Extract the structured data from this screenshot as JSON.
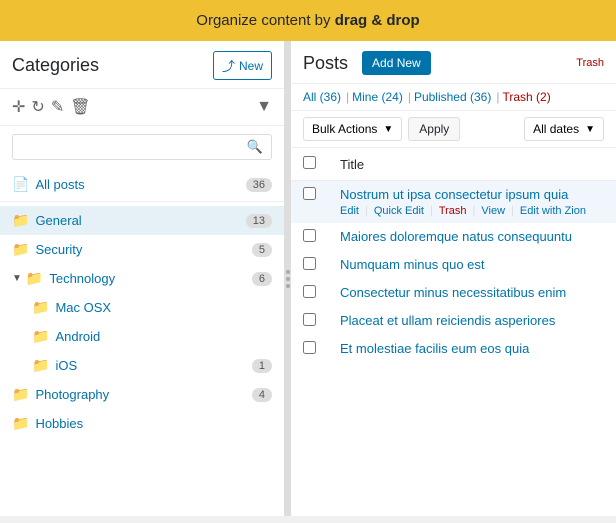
{
  "banner": {
    "text_prefix": "Organize content by ",
    "text_bold": "drag & drop"
  },
  "sidebar": {
    "title": "Categories",
    "new_button": "New",
    "search_placeholder": "",
    "all_posts": {
      "label": "All posts",
      "count": "36"
    },
    "categories": [
      {
        "id": "general",
        "label": "General",
        "count": "13",
        "indent": 0,
        "active": true
      },
      {
        "id": "security",
        "label": "Security",
        "count": "5",
        "indent": 0
      },
      {
        "id": "technology",
        "label": "Technology",
        "count": "6",
        "indent": 0,
        "expanded": true
      },
      {
        "id": "mac-osx",
        "label": "Mac OSX",
        "count": "",
        "indent": 1
      },
      {
        "id": "android",
        "label": "Android",
        "count": "",
        "indent": 1
      },
      {
        "id": "ios",
        "label": "iOS",
        "count": "1",
        "indent": 1
      },
      {
        "id": "photography",
        "label": "Photography",
        "count": "4",
        "indent": 0
      },
      {
        "id": "hobbies",
        "label": "Hobbies",
        "count": "",
        "indent": 0
      }
    ]
  },
  "posts_panel": {
    "title": "Posts",
    "add_new_label": "Add New",
    "filter_links": [
      {
        "id": "all",
        "label": "All",
        "count": "36",
        "active": true
      },
      {
        "id": "mine",
        "label": "Mine",
        "count": "24"
      },
      {
        "id": "published",
        "label": "Published",
        "count": "36"
      },
      {
        "id": "trash",
        "label": "Trash",
        "count": "2",
        "is_trash": true
      }
    ],
    "bulk_actions_label": "Bulk Actions",
    "apply_label": "Apply",
    "dates_label": "All dates",
    "table_header_checkbox": "",
    "table_header_title": "Title",
    "posts": [
      {
        "id": "post1",
        "title": "Nostrum ut ipsa consectetur ipsum quia",
        "actions": [
          {
            "label": "Edit",
            "type": "normal"
          },
          {
            "label": "Quick Edit",
            "type": "normal"
          },
          {
            "label": "Trash",
            "type": "trash"
          },
          {
            "label": "View",
            "type": "normal"
          },
          {
            "label": "Edit with Zion",
            "type": "normal"
          }
        ]
      },
      {
        "id": "post2",
        "title": "Maiores doloremque natus consequuntu",
        "actions": []
      },
      {
        "id": "post3",
        "title": "Numquam minus quo est",
        "actions": []
      },
      {
        "id": "post4",
        "title": "Consectetur minus necessitatibus enim",
        "actions": []
      },
      {
        "id": "post5",
        "title": "Placeat et ullam reiciendis asperiores",
        "actions": []
      },
      {
        "id": "post6",
        "title": "Et molestiae facilis eum eos quia",
        "actions": []
      }
    ]
  }
}
